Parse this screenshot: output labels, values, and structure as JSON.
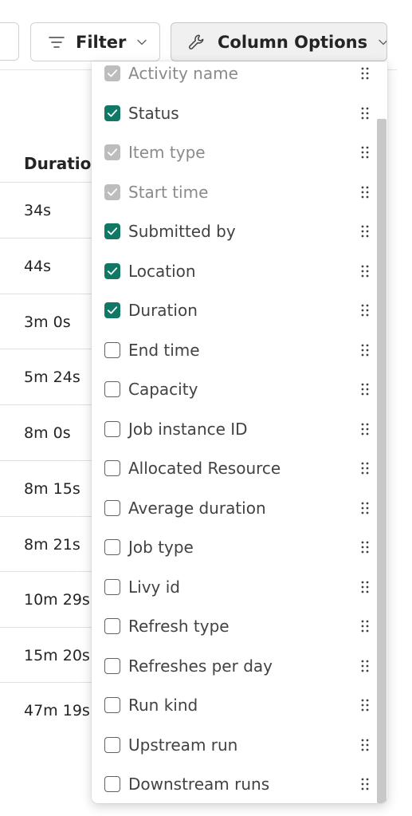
{
  "toolbar": {
    "filter_label": "Filter",
    "column_options_label": "Column Options"
  },
  "table": {
    "header": "Duration",
    "rows": [
      "34s",
      "44s",
      "3m 0s",
      "5m 24s",
      "8m 0s",
      "8m 15s",
      "8m 21s",
      "10m 29s",
      "15m 20s",
      "47m 19s"
    ]
  },
  "column_options": {
    "items": [
      {
        "label": "Activity name",
        "state": "checked-disabled"
      },
      {
        "label": "Status",
        "state": "checked"
      },
      {
        "label": "Item type",
        "state": "checked-disabled"
      },
      {
        "label": "Start time",
        "state": "checked-disabled"
      },
      {
        "label": "Submitted by",
        "state": "checked"
      },
      {
        "label": "Location",
        "state": "checked"
      },
      {
        "label": "Duration",
        "state": "checked"
      },
      {
        "label": "End time",
        "state": "unchecked"
      },
      {
        "label": "Capacity",
        "state": "unchecked"
      },
      {
        "label": "Job instance ID",
        "state": "unchecked"
      },
      {
        "label": "Allocated Resource",
        "state": "unchecked"
      },
      {
        "label": "Average duration",
        "state": "unchecked"
      },
      {
        "label": "Job type",
        "state": "unchecked"
      },
      {
        "label": "Livy id",
        "state": "unchecked"
      },
      {
        "label": "Refresh type",
        "state": "unchecked"
      },
      {
        "label": "Refreshes per day",
        "state": "unchecked"
      },
      {
        "label": "Run kind",
        "state": "unchecked"
      },
      {
        "label": "Upstream run",
        "state": "unchecked"
      },
      {
        "label": "Downstream runs",
        "state": "unchecked"
      }
    ]
  },
  "colors": {
    "checked": "#117865",
    "disabled": "#bdbdbd"
  },
  "icons": {
    "filter": "filter-lines-icon",
    "column_options": "wrench-icon",
    "chevron": "chevron-down-icon",
    "drag": "drag-grip-icon"
  }
}
